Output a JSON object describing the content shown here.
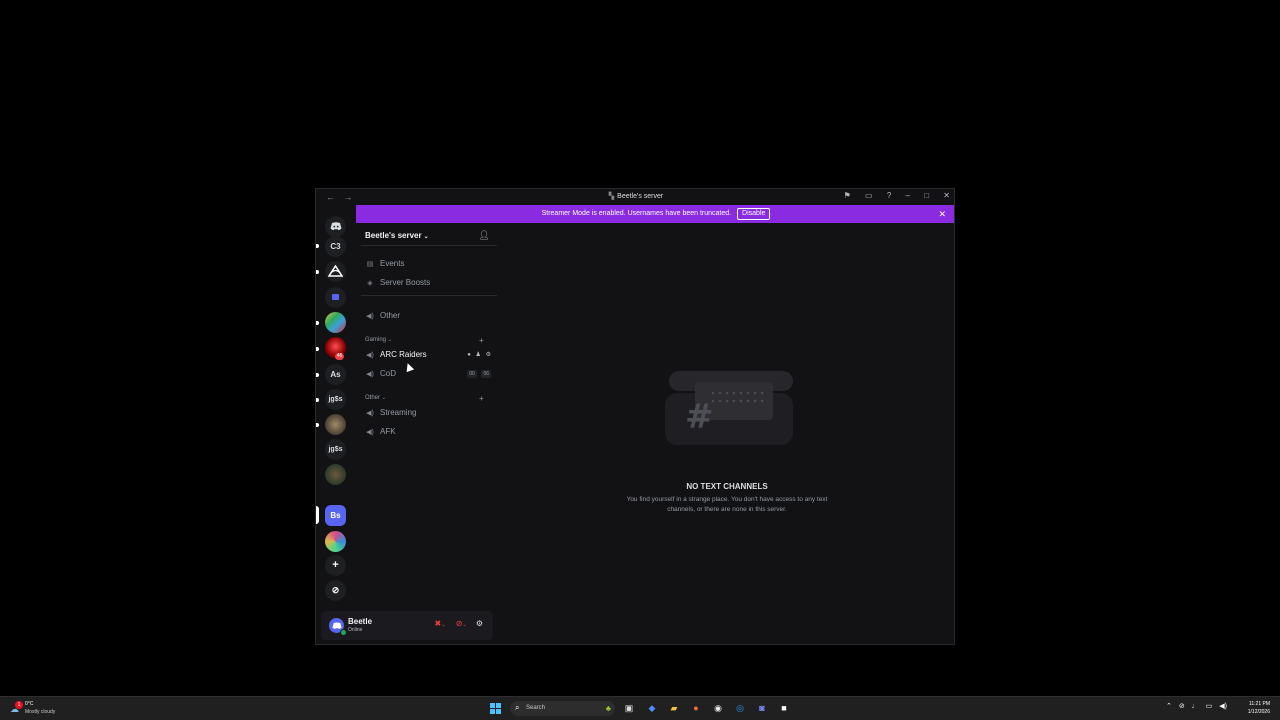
{
  "window": {
    "title": "Beetle's server",
    "back": "←",
    "forward": "→",
    "controls": [
      "⚑",
      "▭",
      "?",
      "–",
      "□",
      "✕"
    ]
  },
  "banner": {
    "message": "Streamer Mode is enabled. Usernames have been truncated.",
    "button": "Disable",
    "close": "✕"
  },
  "servers": [
    {
      "label": "",
      "kind": "discord-home"
    },
    {
      "label": "C3"
    },
    {
      "label": "",
      "kind": "image"
    },
    {
      "label": "",
      "kind": "image"
    },
    {
      "label": "",
      "kind": "image"
    },
    {
      "label": "",
      "kind": "image",
      "badge": "46"
    },
    {
      "label": "As"
    },
    {
      "label": "jg$s"
    },
    {
      "label": "",
      "kind": "image"
    },
    {
      "label": "jg$s"
    },
    {
      "label": "",
      "kind": "image"
    },
    {
      "label": "Bs",
      "selected": true
    },
    {
      "label": "",
      "kind": "image"
    },
    {
      "label": "+"
    },
    {
      "label": "⊘"
    }
  ],
  "server": {
    "name": "Beetle's server",
    "top_items": [
      {
        "label": "Events",
        "icon": "calendar-icon"
      },
      {
        "label": "Server Boosts",
        "icon": "boost-icon"
      }
    ],
    "uncategorized": [
      {
        "label": "Other",
        "icon": "speaker-icon"
      }
    ],
    "categories": [
      {
        "name": "Gaming",
        "channels": [
          {
            "label": "ARC Raiders",
            "active": true
          },
          {
            "label": "CoD",
            "count_left": "00",
            "count_right": "06"
          }
        ]
      },
      {
        "name": "Other",
        "channels": [
          {
            "label": "Streaming"
          },
          {
            "label": "AFK"
          }
        ]
      }
    ]
  },
  "user": {
    "name": "Beetle",
    "status": "Online"
  },
  "empty_state": {
    "title": "NO TEXT CHANNELS",
    "description": "You find yourself in a strange place. You don't have access to any text channels, or there are none in this server."
  },
  "taskbar": {
    "weather_temp": "0°C",
    "weather_cond": "Mostly cloudy",
    "weather_badge": "1",
    "search_placeholder": "Search",
    "time": "11:21 PM",
    "date": "1/12/2026"
  }
}
